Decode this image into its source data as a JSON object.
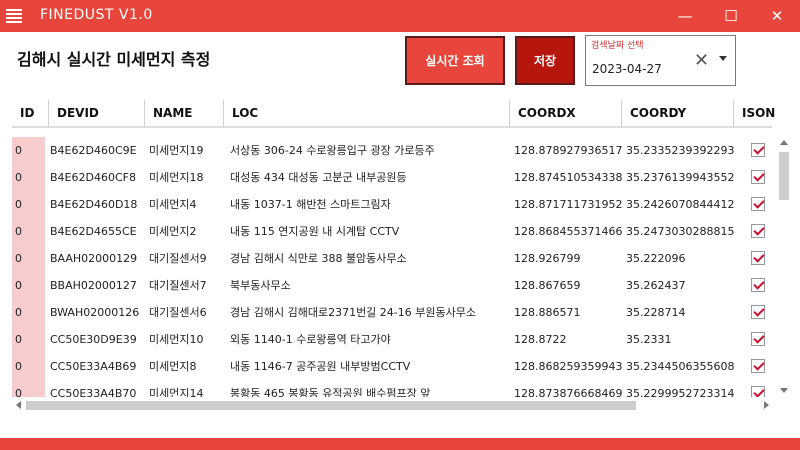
{
  "window": {
    "title": "FINEDUST V1.0",
    "minimize": "—",
    "maximize": "☐",
    "close": "✕"
  },
  "header": {
    "page_title": "김해시 실시간 미세먼지 측정",
    "realtime_button": "실시간 조회",
    "save_button": "저장",
    "date_label": "검색날짜 선택",
    "date_value": "2023-04-27",
    "clear_glyph": "✕"
  },
  "colors": {
    "accent": "#e8453c",
    "save": "#b7160f",
    "check": "#c8102e",
    "id_cell": "#f6cccc"
  },
  "columns": [
    "ID",
    "DEVID",
    "NAME",
    "LOC",
    "COORDX",
    "COORDY",
    "ISON"
  ],
  "rows": [
    {
      "id": "0",
      "devid": "B4E62D460C9E",
      "name": "미세먼지19",
      "loc": "서상동 306-24 수로왕릉입구 광장 가로등주",
      "coordx": "128.878927936517",
      "coordy": "35.2335239392293",
      "ison": true
    },
    {
      "id": "0",
      "devid": "B4E62D460CF8",
      "name": "미세먼지18",
      "loc": "대성동 434 대성동 고분군 내부공원등",
      "coordx": "128.874510534338",
      "coordy": "35.2376139943552",
      "ison": true
    },
    {
      "id": "0",
      "devid": "B4E62D460D18",
      "name": "미세먼지4",
      "loc": "내동 1037-1 해반천 스마트그림자",
      "coordx": "128.871711731952",
      "coordy": "35.2426070844412",
      "ison": true
    },
    {
      "id": "0",
      "devid": "B4E62D4655CE",
      "name": "미세먼지2",
      "loc": "내동 115 연지공원 내 시계탑 CCTV",
      "coordx": "128.868455371466",
      "coordy": "35.2473030288815",
      "ison": true
    },
    {
      "id": "0",
      "devid": "BAAH02000129",
      "name": "대기질센서9",
      "loc": "경남 김해시 식만로 388 불암동사무소",
      "coordx": "128.926799",
      "coordy": "35.222096",
      "ison": true
    },
    {
      "id": "0",
      "devid": "BBAH02000127",
      "name": "대기질센서7",
      "loc": "북부동사무소",
      "coordx": "128.867659",
      "coordy": "35.262437",
      "ison": true
    },
    {
      "id": "0",
      "devid": "BWAH02000126",
      "name": "대기질센서6",
      "loc": "경남 김해시 김해대로2371번길 24-16 부원동사무소",
      "coordx": "128.886571",
      "coordy": "35.228714",
      "ison": true
    },
    {
      "id": "0",
      "devid": "CC50E30D9E39",
      "name": "미세먼지10",
      "loc": "외동 1140-1 수로왕릉역 타고가야",
      "coordx": "128.8722",
      "coordy": "35.2331",
      "ison": true
    },
    {
      "id": "0",
      "devid": "CC50E33A4B69",
      "name": "미세먼지8",
      "loc": "내동 1146-7 공주공원 내부방범CCTV",
      "coordx": "128.868259359943",
      "coordy": "35.2344506355608",
      "ison": true
    },
    {
      "id": "0",
      "devid": "CC50E33A4B70",
      "name": "미세먼지14",
      "loc": "봉황동 465 봉황동 유적공원 배수펌프장 앞",
      "coordx": "128.873876668469",
      "coordy": "35.2299952723314",
      "ison": true
    }
  ]
}
